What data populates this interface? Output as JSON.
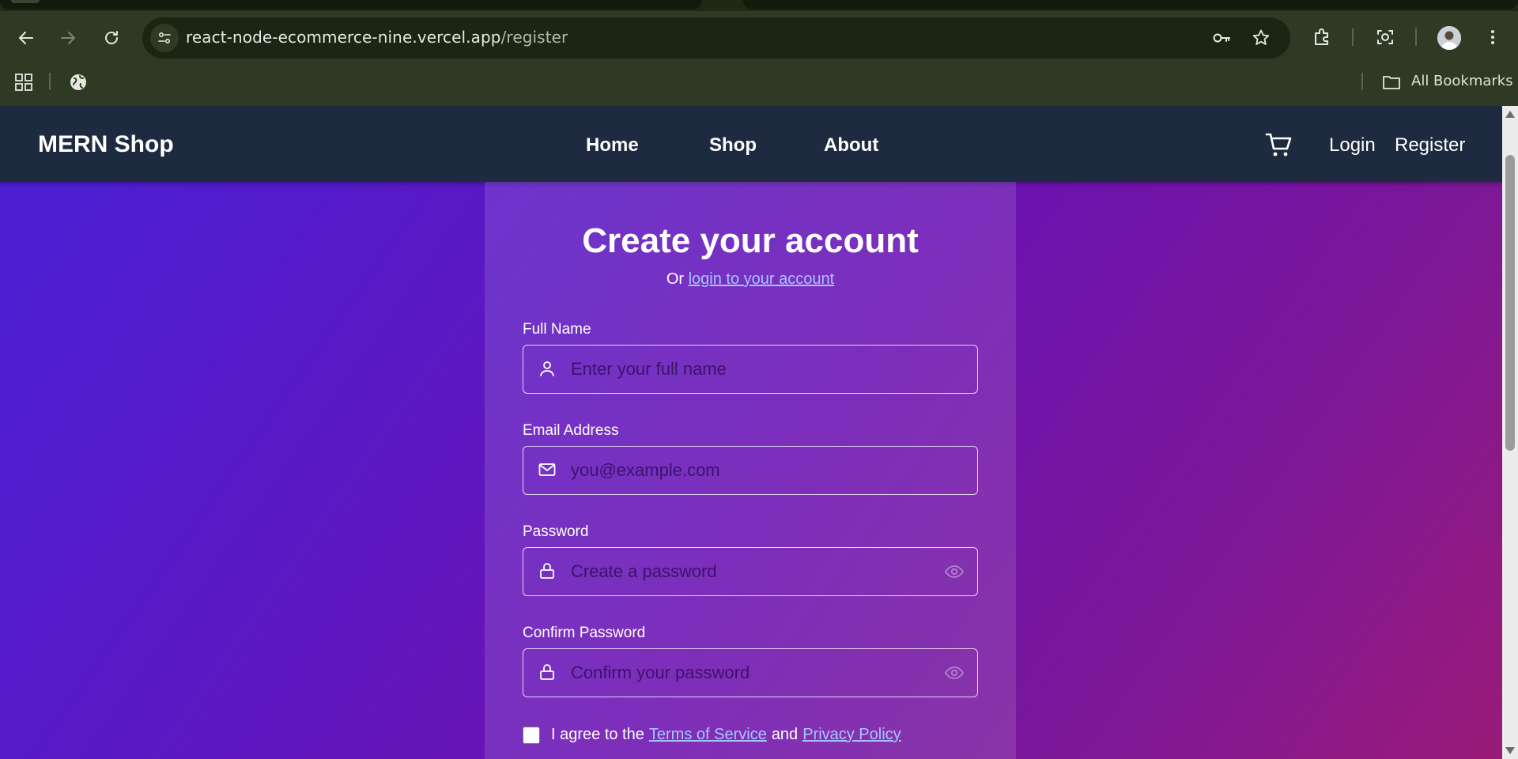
{
  "browser": {
    "url_host": "react-node-ecommerce-nine.vercel.app",
    "url_path": "/register",
    "bookmarks_label": "All Bookmarks"
  },
  "site": {
    "brand": "MERN Shop",
    "nav": [
      "Home",
      "Shop",
      "About"
    ],
    "login": "Login",
    "register": "Register"
  },
  "form": {
    "title": "Create your account",
    "subtitle_prefix": "Or",
    "subtitle_link": "login to your account",
    "fields": [
      {
        "label": "Full Name",
        "placeholder": "Enter your full name",
        "icon": "user-icon"
      },
      {
        "label": "Email Address",
        "placeholder": "you@example.com",
        "icon": "mail-icon"
      },
      {
        "label": "Password",
        "placeholder": "Create a password",
        "icon": "lock-icon"
      },
      {
        "label": "Confirm Password",
        "placeholder": "Confirm your password",
        "icon": "lock-icon"
      }
    ],
    "agree_prefix": "I agree to the",
    "terms": "Terms of Service",
    "and": "and",
    "privacy": "Privacy Policy"
  },
  "colors": {
    "nav_bg": "#1e2a3f",
    "link": "#a8c4ff",
    "gradient_start": "#4a20d6",
    "gradient_end": "#9a1a78"
  }
}
